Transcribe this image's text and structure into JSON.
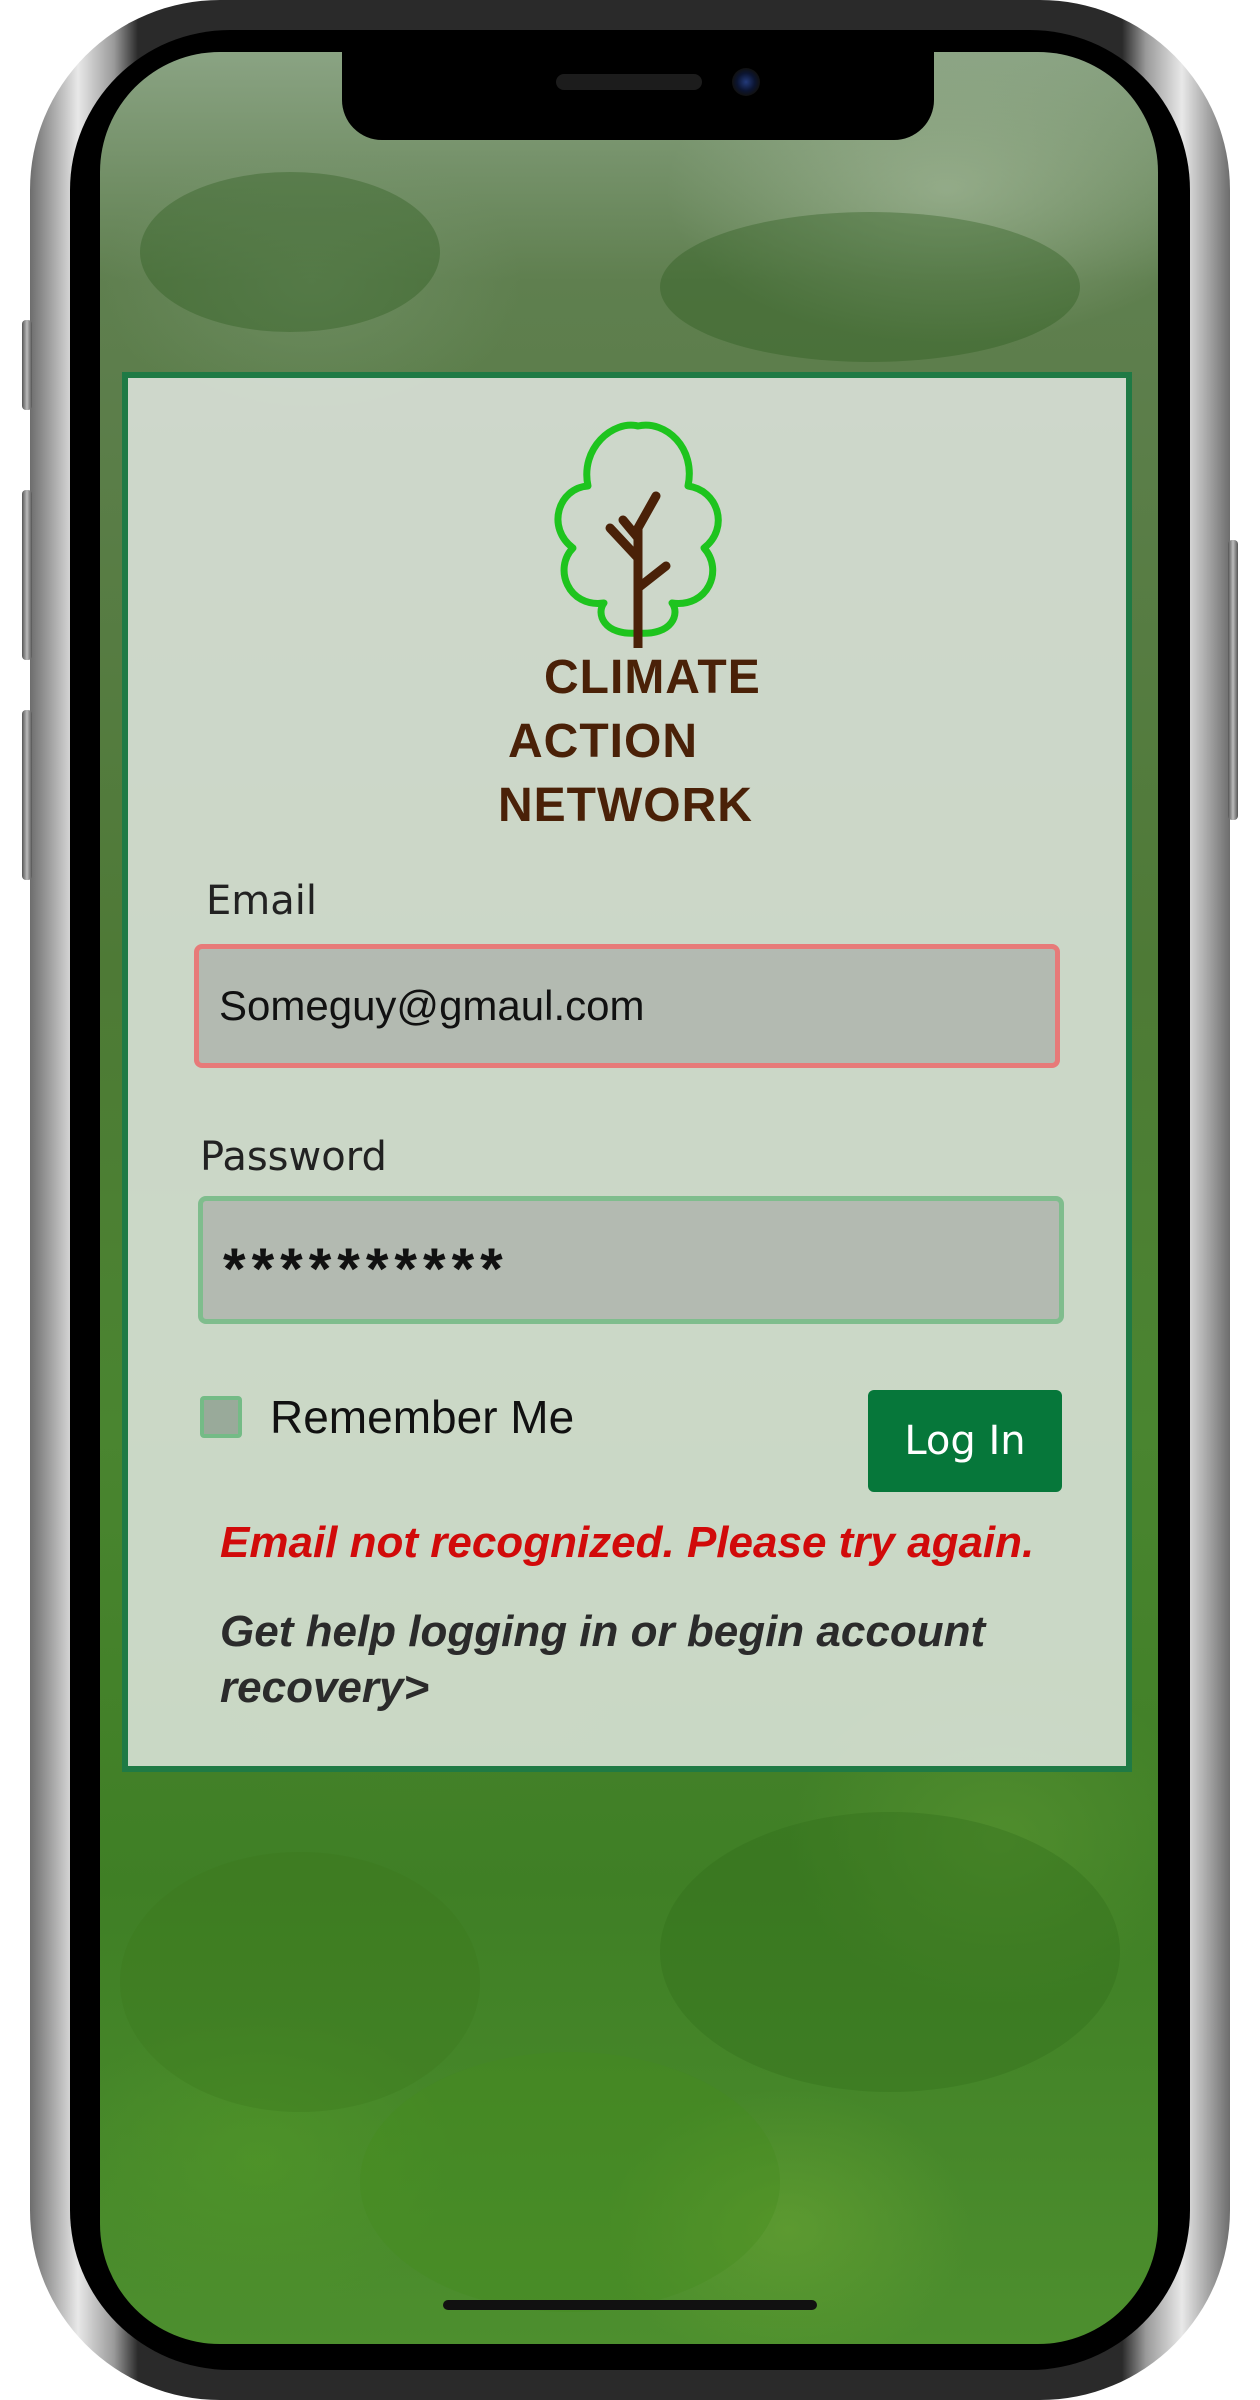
{
  "app": {
    "logo_lines": [
      "CLIMATE",
      "ACTION",
      "NETWORK"
    ]
  },
  "form": {
    "email_label": "Email",
    "email_value": "Someguy@gmaul.com",
    "password_label": "Password",
    "password_value": "**********",
    "remember_label": "Remember Me",
    "login_label": "Log In",
    "error_message": "Email not recognized. Please try again.",
    "help_link": "Get help logging in or begin account recovery>"
  },
  "colors": {
    "brand_green": "#06773a",
    "logo_tree_green": "#1ec41e",
    "logo_brown": "#4a2108",
    "error_red": "#d10a0a"
  }
}
